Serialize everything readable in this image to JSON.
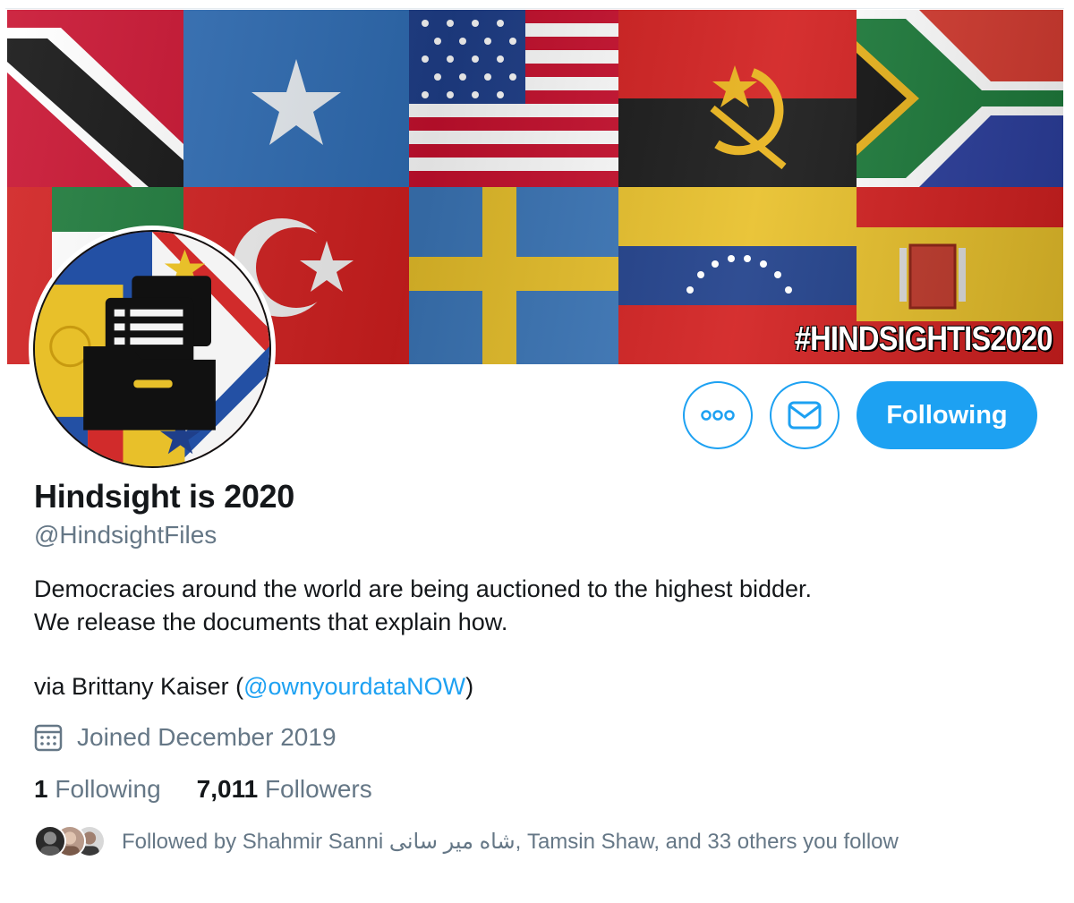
{
  "banner": {
    "hashtag": "#HINDSIGHTIS2020",
    "flags": [
      "trinidad-and-tobago",
      "somalia",
      "united-states",
      "angola",
      "south-africa",
      "uae",
      "turkey",
      "sweden",
      "venezuela",
      "spain"
    ]
  },
  "avatar": {
    "icon": "document-folder-icon"
  },
  "actions": {
    "more_icon": "more-dots-icon",
    "message_icon": "envelope-icon",
    "following_label": "Following"
  },
  "profile": {
    "name": "Hindsight is 2020",
    "handle": "@HindsightFiles",
    "bio": "Democracies around the world are being auctioned to the highest bidder.\nWe release the documents that explain how.",
    "via_prefix": "via Brittany Kaiser (",
    "via_link": "@ownyourdataNOW",
    "via_suffix": ")",
    "joined": "Joined December 2019"
  },
  "stats": {
    "following_count": "1",
    "following_label": "Following",
    "followers_count": "7,011",
    "followers_label": "Followers"
  },
  "followed_by": {
    "text": "Followed by Shahmir Sanni شاه میر سانی, Tamsin Shaw, and 33 others you follow"
  },
  "colors": {
    "accent": "#1da1f2",
    "text": "#14171a",
    "secondary": "#657786"
  }
}
